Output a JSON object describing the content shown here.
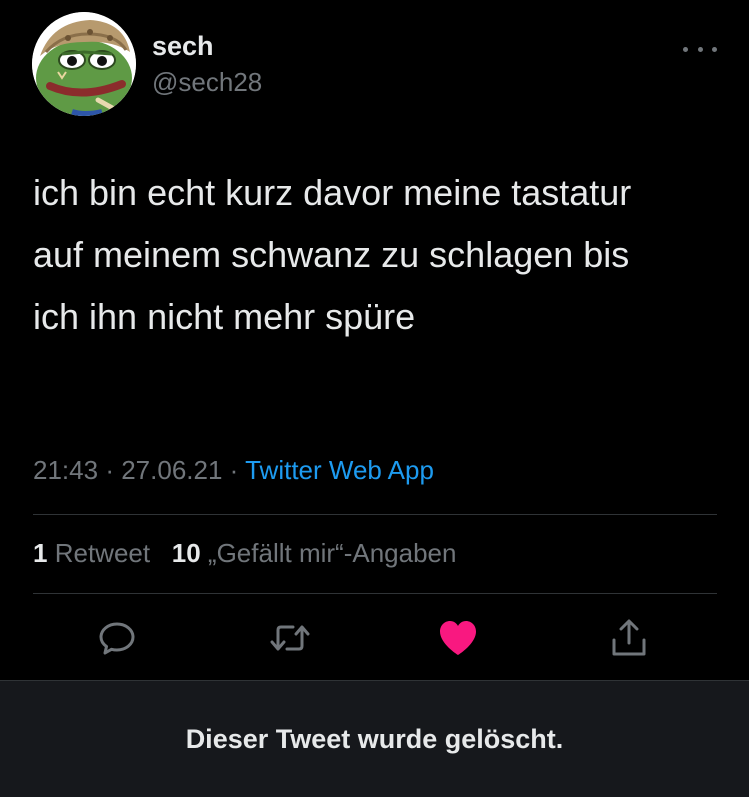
{
  "author": {
    "name": "sech",
    "handle": "@sech28",
    "avatar_icon": "pepe-frog-avatar-icon"
  },
  "tweet": {
    "text": "ich bin echt kurz davor meine tastatur auf meinem schwanz zu schlagen bis ich ihn nicht mehr spüre",
    "time": "21:43",
    "date": "27.06.21",
    "separator": "·",
    "source": "Twitter Web App"
  },
  "stats": {
    "retweet_count": "1",
    "retweet_label": "Retweet",
    "like_count": "10",
    "like_label": "„Gefällt mir“-Angaben"
  },
  "actions": {
    "reply_icon": "reply-icon",
    "retweet_icon": "retweet-icon",
    "like_icon": "heart-icon",
    "share_icon": "share-icon",
    "liked": true
  },
  "banner": {
    "text": "Dieser Tweet wurde gelöscht."
  },
  "colors": {
    "background": "#000000",
    "text": "#e7e9ea",
    "muted": "#71767b",
    "link": "#1d9bf0",
    "like": "#f91880",
    "banner_bg": "#16181c"
  }
}
